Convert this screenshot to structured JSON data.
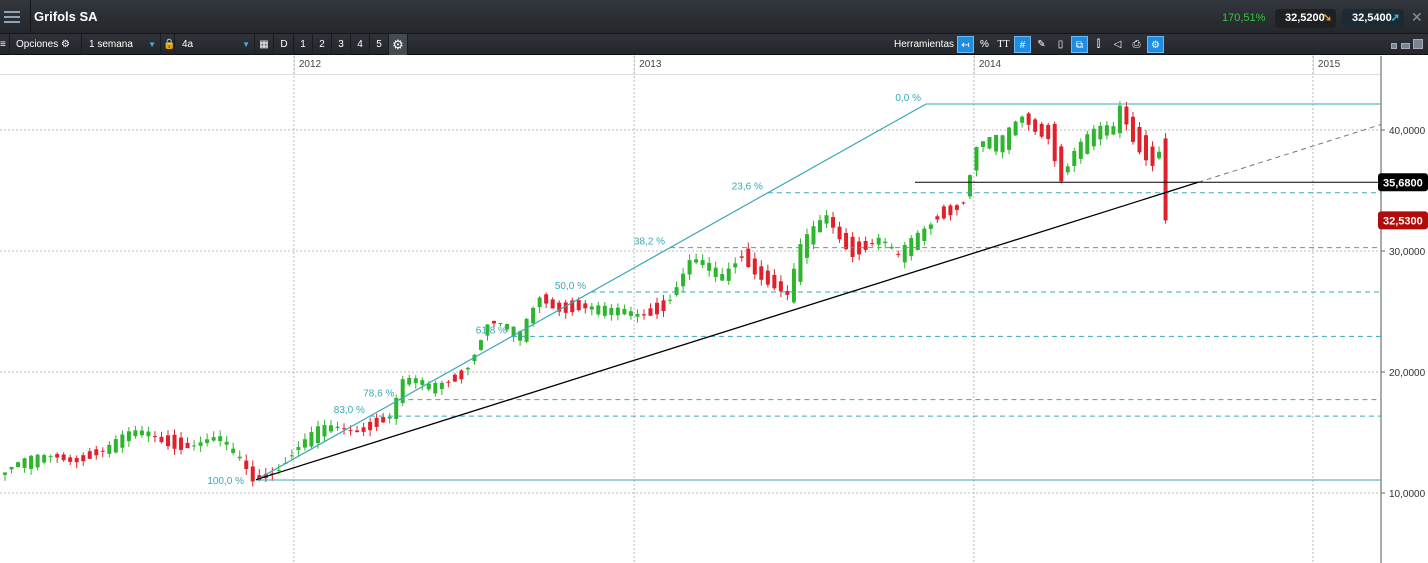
{
  "header": {
    "title": "Grifols SA",
    "change_pct": "170,51%",
    "bid": "32,5200",
    "ask": "32,5400",
    "bid_icon": "arrow-down-icon",
    "ask_icon": "arrow-up-icon"
  },
  "toolbar": {
    "options_label": "Opciones",
    "interval": "1 semana",
    "range": "4a",
    "periods": [
      "D",
      "1",
      "2",
      "3",
      "4",
      "5"
    ],
    "tools_label": "Herramientas",
    "percent_label": "%",
    "text_label": "TT"
  },
  "colors": {
    "up": "#2db52d",
    "down": "#e0202a",
    "fib": "#3aa8b8",
    "trend": "#000000"
  },
  "chart_data": {
    "type": "candlestick",
    "x_unit": "weeks",
    "years": [
      "2012",
      "2013",
      "2014",
      "2015"
    ],
    "y_ticks": [
      "10,0000",
      "20,0000",
      "30,0000",
      "40,0000"
    ],
    "y_tick_values": [
      10,
      20,
      30,
      40
    ],
    "ylim": [
      6,
      47
    ],
    "close_waypoints": [
      [
        0,
        11.7
      ],
      [
        8,
        13.1
      ],
      [
        15,
        13.4
      ],
      [
        19,
        14.4
      ],
      [
        22,
        15.0
      ],
      [
        27,
        14.2
      ],
      [
        33,
        14.0
      ],
      [
        36,
        12.7
      ],
      [
        38,
        11.2
      ],
      [
        42,
        12.5
      ],
      [
        48,
        14.8
      ],
      [
        54,
        15.6
      ],
      [
        59,
        16.4
      ],
      [
        61,
        18.9
      ],
      [
        65,
        18.5
      ],
      [
        70,
        20.2
      ],
      [
        74,
        24.0
      ],
      [
        79,
        22.6
      ],
      [
        82,
        26.3
      ],
      [
        88,
        25.5
      ],
      [
        93,
        24.4
      ],
      [
        97,
        25.0
      ],
      [
        101,
        25.9
      ],
      [
        105,
        28.8
      ],
      [
        110,
        27.6
      ],
      [
        113,
        30.1
      ],
      [
        116,
        28.5
      ],
      [
        120,
        25.9
      ],
      [
        122,
        29.6
      ],
      [
        126,
        32.9
      ],
      [
        130,
        30.5
      ],
      [
        134,
        30.9
      ],
      [
        137,
        28.8
      ],
      [
        143,
        33.4
      ],
      [
        147,
        34.6
      ],
      [
        149,
        38.3
      ],
      [
        153,
        38.5
      ],
      [
        156,
        41.2
      ],
      [
        160,
        40.4
      ],
      [
        162,
        36.3
      ],
      [
        164,
        37.9
      ],
      [
        170,
        40.0
      ],
      [
        171,
        42.2
      ],
      [
        173,
        40.0
      ],
      [
        176,
        37.9
      ],
      [
        177,
        38.7
      ],
      [
        178,
        32.53
      ]
    ],
    "fibonacci": {
      "high": 42.15,
      "low": 11.07,
      "levels": [
        {
          "pct": 0,
          "label": "0,0 %"
        },
        {
          "pct": 23.6,
          "label": "23,6 %"
        },
        {
          "pct": 38.2,
          "label": "38,2 %"
        },
        {
          "pct": 50,
          "label": "50,0 %"
        },
        {
          "pct": 61.8,
          "label": "61,8 %"
        },
        {
          "pct": 78.6,
          "label": "78,6 %"
        },
        {
          "pct": 83,
          "label": "83,0 %"
        },
        {
          "pct": 100,
          "label": "100,0 %"
        }
      ]
    },
    "trendline": {
      "from": [
        38.5,
        11.1
      ],
      "to": [
        183,
        35.68
      ]
    },
    "horizontal_line": {
      "value": 35.68,
      "label": "35,6800"
    },
    "last_price": {
      "value": 32.53,
      "label": "32,5300"
    }
  }
}
